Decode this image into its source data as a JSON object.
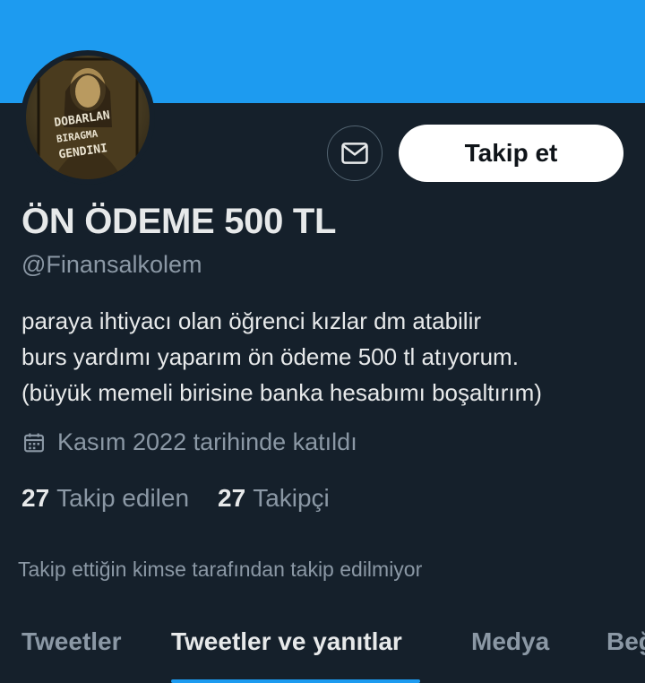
{
  "profile": {
    "display_name": "ÖN ÖDEME 500 TL",
    "handle": "@Finansalkolem",
    "bio_lines": [
      "paraya ihtiyacı olan öğrenci kızlar dm atabilir",
      "burs yardımı yaparım ön ödeme 500 tl atıyorum.",
      "(büyük memeli birisine banka hesabımı boşaltırım)"
    ],
    "joined": "Kasım 2022 tarihinde katıldı",
    "avatar_text": "DOBARLAN BIRAGMA GENDINI"
  },
  "actions": {
    "follow_label": "Takip et",
    "message_icon": "envelope-icon"
  },
  "stats": {
    "following_count": "27",
    "following_label": "Takip edilen",
    "followers_count": "27",
    "followers_label": "Takipçi"
  },
  "followers_you_know": "Takip ettiğin kimse tarafından takip edilmiyor",
  "tabs": [
    {
      "label": "Tweetler",
      "active": false
    },
    {
      "label": "Tweetler ve yanıtlar",
      "active": true
    },
    {
      "label": "Medya",
      "active": false
    },
    {
      "label": "Beğeni",
      "active": false
    }
  ],
  "colors": {
    "background": "#15202b",
    "banner": "#1d9bf0",
    "accent": "#1d9bf0",
    "primary_text": "#e7e9ea",
    "secondary_text": "#8b98a5"
  }
}
